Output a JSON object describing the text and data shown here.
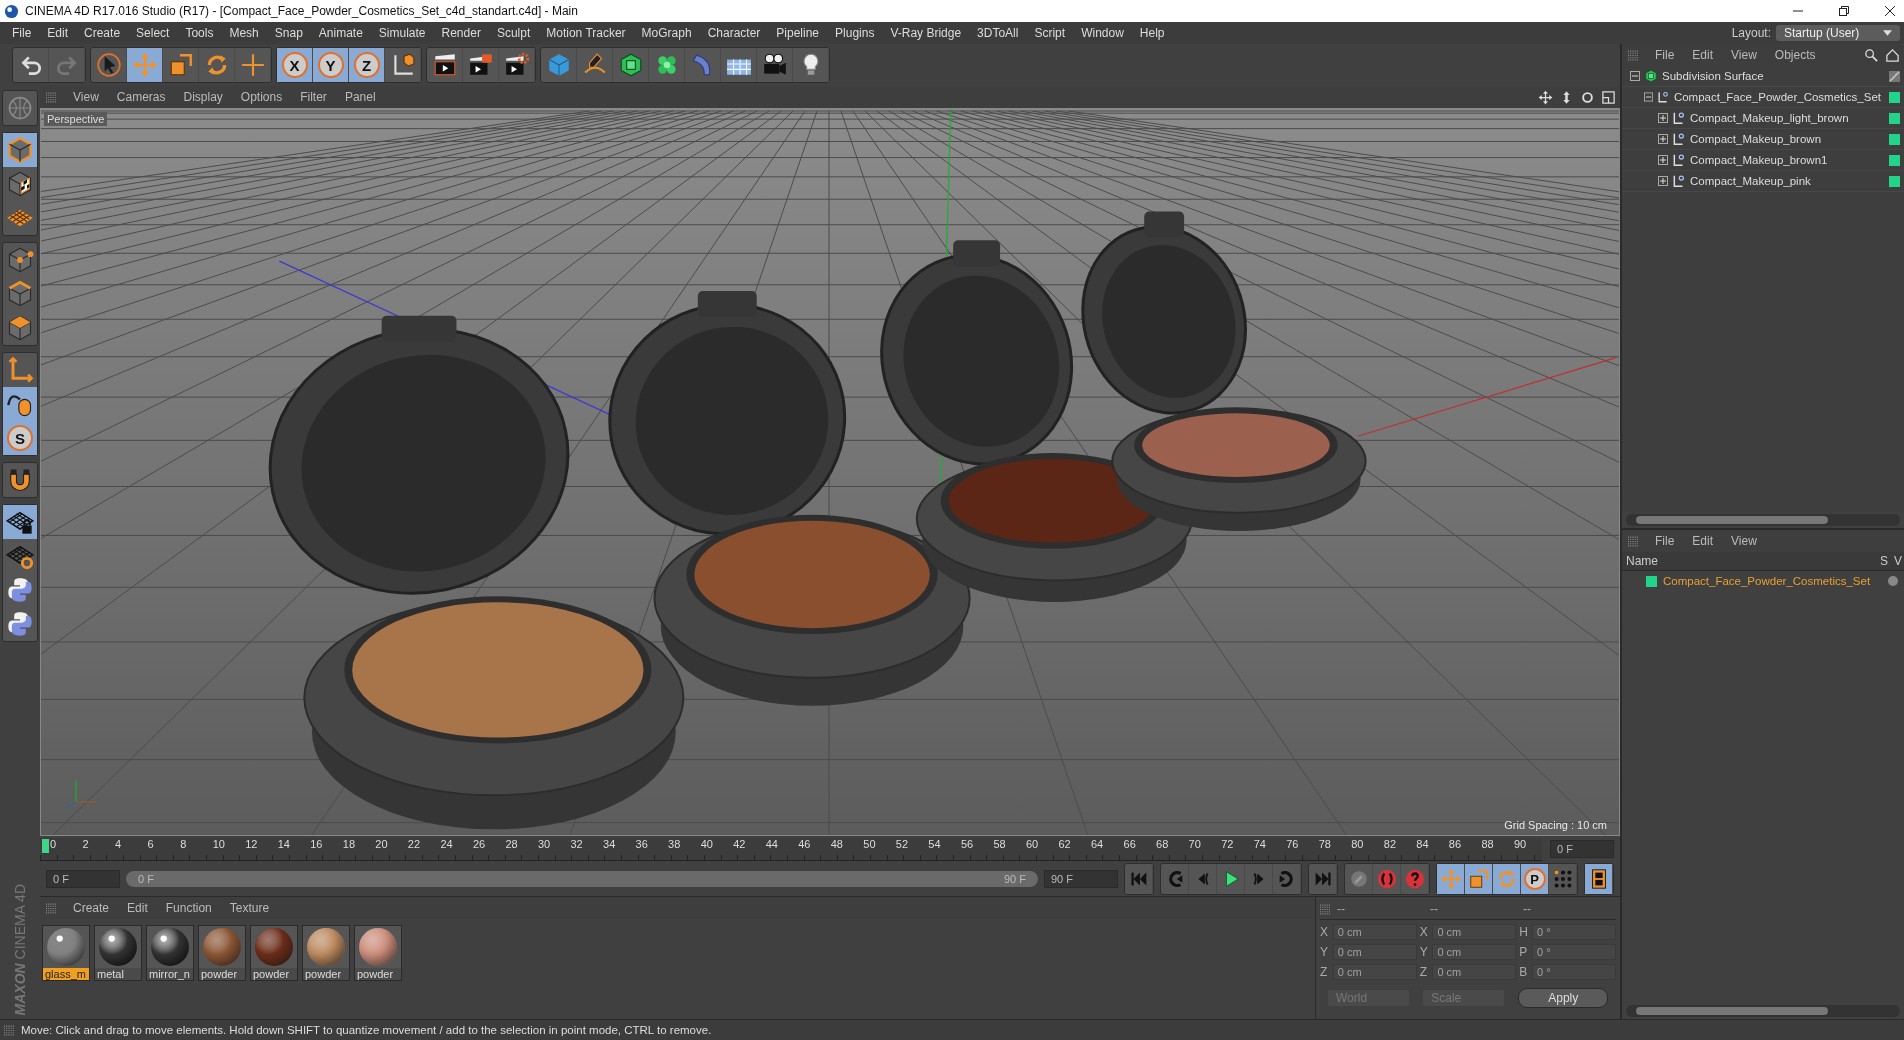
{
  "window": {
    "title": "CINEMA 4D R17.016 Studio (R17) - [Compact_Face_Powder_Cosmetics_Set_c4d_standart.c4d] - Main"
  },
  "menu": [
    "File",
    "Edit",
    "Create",
    "Select",
    "Tools",
    "Mesh",
    "Snap",
    "Animate",
    "Simulate",
    "Render",
    "Sculpt",
    "Motion Tracker",
    "MoGraph",
    "Character",
    "Pipeline",
    "Plugins",
    "V-Ray Bridge",
    "3DToAll",
    "Script",
    "Window",
    "Help"
  ],
  "layout": {
    "label": "Layout:",
    "value": "Startup (User)"
  },
  "toolbar": [
    [
      {
        "kind": "undo",
        "selected": false
      },
      {
        "kind": "redo",
        "selected": false
      }
    ],
    [
      {
        "kind": "select",
        "selected": false
      },
      {
        "kind": "move",
        "selected": true
      },
      {
        "kind": "scale",
        "selected": false
      },
      {
        "kind": "rotate",
        "selected": false
      },
      {
        "kind": "add",
        "selected": false
      }
    ],
    [
      {
        "kind": "letter",
        "label": "X",
        "selected": true
      },
      {
        "kind": "letter",
        "label": "Y",
        "selected": true
      },
      {
        "kind": "letter",
        "label": "Z",
        "selected": true
      },
      {
        "kind": "coord",
        "selected": false
      }
    ],
    [
      {
        "kind": "clapper",
        "selected": false
      },
      {
        "kind": "clapper-play",
        "selected": false
      },
      {
        "kind": "clapper-gear",
        "selected": false
      }
    ],
    [
      {
        "kind": "cube",
        "selected": false
      },
      {
        "kind": "pen",
        "selected": false
      },
      {
        "kind": "subdiv",
        "selected": false
      },
      {
        "kind": "cloner",
        "selected": false
      },
      {
        "kind": "deformer",
        "selected": false
      },
      {
        "kind": "floor",
        "selected": false
      },
      {
        "kind": "camera",
        "selected": false
      },
      {
        "kind": "light",
        "selected": false
      }
    ]
  ],
  "left_toolbar": [
    [
      {
        "kind": "globe",
        "selected": false
      }
    ],
    [
      {
        "kind": "model",
        "selected": true
      },
      {
        "kind": "texture",
        "selected": false
      },
      {
        "kind": "workplane",
        "selected": false
      }
    ],
    [
      {
        "kind": "points",
        "selected": false
      },
      {
        "kind": "edges",
        "selected": false
      },
      {
        "kind": "polys",
        "selected": false
      }
    ],
    [
      {
        "kind": "axis",
        "selected": false
      },
      {
        "kind": "tweak",
        "selected": true
      },
      {
        "kind": "letter",
        "label": "S",
        "selected": true
      }
    ],
    [
      {
        "kind": "magnet",
        "selected": false
      }
    ],
    [
      {
        "kind": "grid-lock",
        "selected": true
      },
      {
        "kind": "grid-rotate",
        "selected": false
      },
      {
        "kind": "python",
        "selected": false
      },
      {
        "kind": "python",
        "selected": false
      }
    ]
  ],
  "viewport": {
    "menu": [
      "View",
      "Cameras",
      "Display",
      "Options",
      "Filter",
      "Panel"
    ],
    "camera": "Perspective",
    "grid_spacing": "Grid Spacing : 10 cm"
  },
  "timeline": {
    "ticks": [
      "0",
      "2",
      "4",
      "6",
      "8",
      "10",
      "12",
      "14",
      "16",
      "18",
      "20",
      "22",
      "24",
      "26",
      "28",
      "30",
      "32",
      "34",
      "36",
      "38",
      "40",
      "42",
      "44",
      "46",
      "48",
      "50",
      "52",
      "54",
      "56",
      "58",
      "60",
      "62",
      "64",
      "66",
      "68",
      "70",
      "72",
      "74",
      "76",
      "78",
      "80",
      "82",
      "84",
      "86",
      "88",
      "90"
    ],
    "current_frame": "0 F",
    "start_field": "0 F",
    "range": {
      "start": "0 F",
      "end": "90 F",
      "level": 1
    },
    "end_field": "90 F",
    "transport": [
      [
        {
          "kind": "first",
          "selected": false
        }
      ],
      [
        {
          "kind": "prev-key",
          "selected": false
        },
        {
          "kind": "prev",
          "selected": false
        },
        {
          "kind": "play",
          "selected": false
        },
        {
          "kind": "next",
          "selected": false
        },
        {
          "kind": "next-key",
          "selected": false
        }
      ],
      [
        {
          "kind": "last",
          "selected": false
        }
      ],
      [
        {
          "kind": "record-off",
          "selected": false
        },
        {
          "kind": "record",
          "selected": false
        },
        {
          "kind": "help",
          "selected": false
        }
      ],
      [
        {
          "kind": "move",
          "selected": true
        },
        {
          "kind": "scale",
          "selected": true
        },
        {
          "kind": "rotate",
          "selected": true
        },
        {
          "kind": "letter",
          "label": "P",
          "selected": true
        },
        {
          "kind": "dots",
          "selected": false
        }
      ],
      [
        {
          "kind": "film",
          "selected": true
        }
      ]
    ]
  },
  "materials": {
    "menu": [
      "Create",
      "Edit",
      "Function",
      "Texture"
    ],
    "items": [
      {
        "name": "glass_m",
        "kind": "glass",
        "selected": true
      },
      {
        "name": "metal",
        "kind": "chrome",
        "selected": false
      },
      {
        "name": "mirror_n",
        "kind": "chrome",
        "selected": false
      },
      {
        "name": "powder",
        "kind": "matte",
        "color": "#8a5433",
        "selected": false
      },
      {
        "name": "powder",
        "kind": "matte",
        "color": "#6a2c18",
        "selected": false
      },
      {
        "name": "powder",
        "kind": "matte",
        "color": "#b9875c",
        "selected": false
      },
      {
        "name": "powder",
        "kind": "matte",
        "color": "#c98a78",
        "selected": false
      }
    ]
  },
  "coordinates": {
    "headers": [
      "--",
      "--",
      "--"
    ],
    "rows": [
      [
        {
          "label": "X",
          "value": "0 cm"
        },
        {
          "label": "X",
          "value": "0 cm"
        },
        {
          "label": "H",
          "value": "0 °"
        }
      ],
      [
        {
          "label": "Y",
          "value": "0 cm"
        },
        {
          "label": "Y",
          "value": "0 cm"
        },
        {
          "label": "P",
          "value": "0 °"
        }
      ],
      [
        {
          "label": "Z",
          "value": "0 cm"
        },
        {
          "label": "Z",
          "value": "0 cm"
        },
        {
          "label": "B",
          "value": "0 °"
        }
      ]
    ],
    "space": "World",
    "mode": "Scale",
    "apply": "Apply"
  },
  "objects": {
    "menu": [
      "File",
      "Edit",
      "View",
      "Objects"
    ],
    "tree": [
      {
        "name": "Subdivision Surface",
        "kind": "subdiv",
        "expanded": true,
        "children": [
          {
            "name": "Compact_Face_Powder_Cosmetics_Set",
            "kind": "null",
            "expanded": true,
            "color": "#22d38a",
            "children": [
              {
                "name": "Compact_Makeup_light_brown",
                "kind": "null",
                "expanded": false,
                "color": "#22d38a"
              },
              {
                "name": "Compact_Makeup_brown",
                "kind": "null",
                "expanded": false,
                "color": "#22d38a"
              },
              {
                "name": "Compact_Makeup_brown1",
                "kind": "null",
                "expanded": false,
                "color": "#22d38a"
              },
              {
                "name": "Compact_Makeup_pink",
                "kind": "null",
                "expanded": false,
                "color": "#22d38a"
              }
            ]
          }
        ]
      }
    ]
  },
  "attributes": {
    "menu": [
      "File",
      "Edit",
      "View"
    ],
    "columns": [
      "Name",
      "S",
      "V"
    ],
    "rows": [
      {
        "name": "Compact_Face_Powder_Cosmetics_Set",
        "color": "#22d38a"
      }
    ]
  },
  "brand": {
    "top": "MAXON",
    "bottom": "CINEMA 4D"
  },
  "status_bar": "Move: Click and drag to move elements. Hold down SHIFT to quantize movement / add to the selection in point mode, CTRL to remove."
}
